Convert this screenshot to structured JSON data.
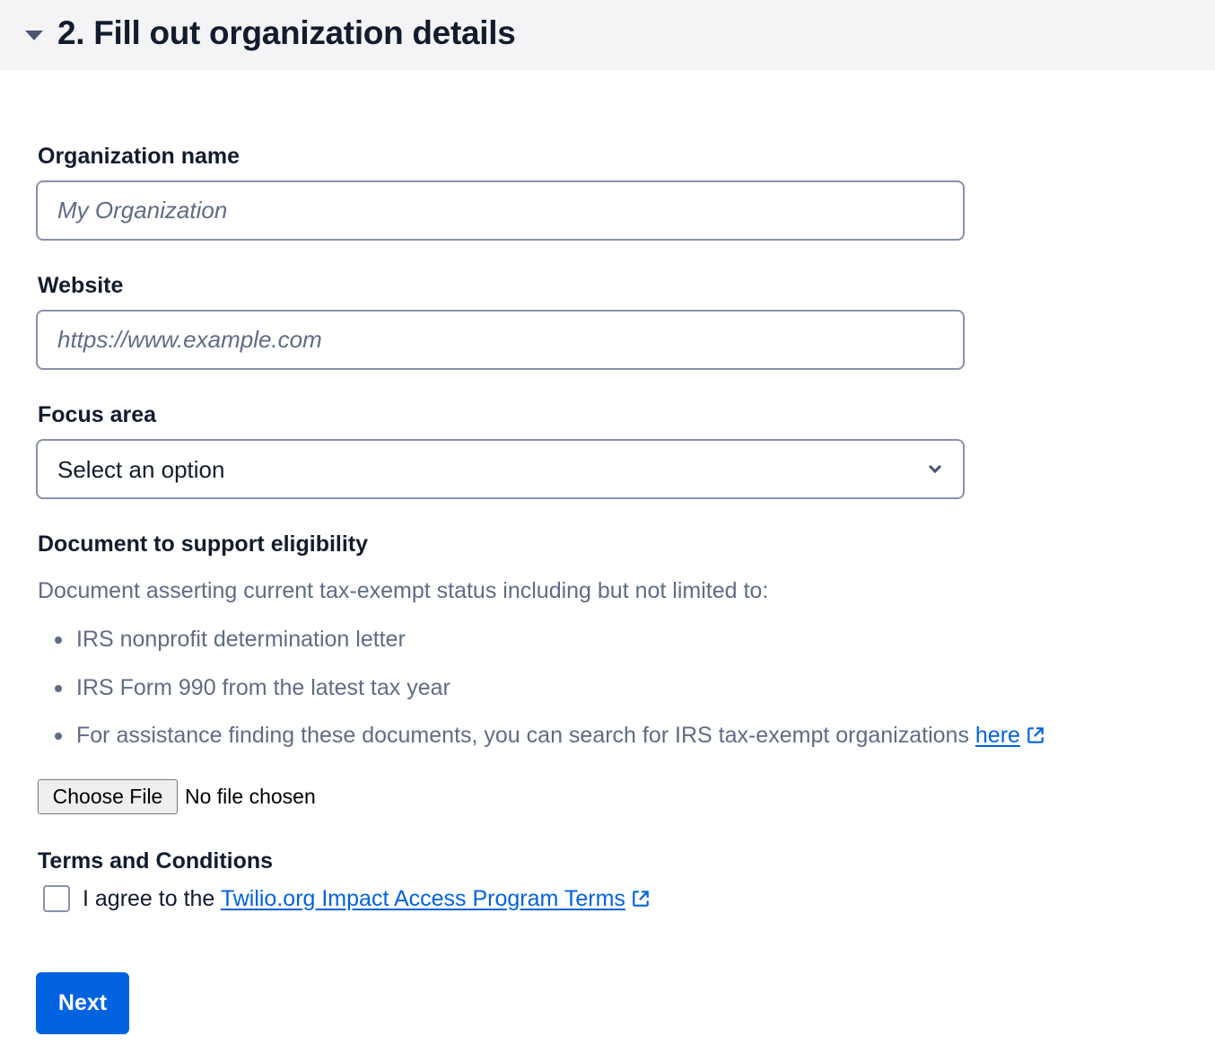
{
  "section": {
    "title": "2. Fill out organization details"
  },
  "form": {
    "org_name": {
      "label": "Organization name",
      "placeholder": "My Organization",
      "value": ""
    },
    "website": {
      "label": "Website",
      "placeholder": "https://www.example.com",
      "value": ""
    },
    "focus_area": {
      "label": "Focus area",
      "selected": "Select an option"
    },
    "document": {
      "label": "Document to support eligibility",
      "helper": "Document asserting current tax-exempt status including but not limited to:",
      "bullets": [
        "IRS nonprofit determination letter",
        "IRS Form 990 from the latest tax year",
        "For assistance finding these documents, you can search for IRS tax-exempt organizations"
      ],
      "bullet_link": "here",
      "file_button": "Choose File",
      "file_status": "No file chosen"
    },
    "terms": {
      "label": "Terms and Conditions",
      "agree_prefix": "I agree to the",
      "agree_link": "Twilio.org Impact Access Program Terms",
      "checked": false
    },
    "next_label": "Next"
  },
  "colors": {
    "header_bg": "#f4f4f6",
    "text_primary": "#121c2d",
    "text_weak": "#606b85",
    "link": "#0263e0",
    "primary_button": "#0263e0",
    "border": "#8891aa"
  },
  "icons": {
    "caret": "caret-down-icon",
    "select_chevron": "chevron-down-icon",
    "external_link": "external-link-icon"
  }
}
